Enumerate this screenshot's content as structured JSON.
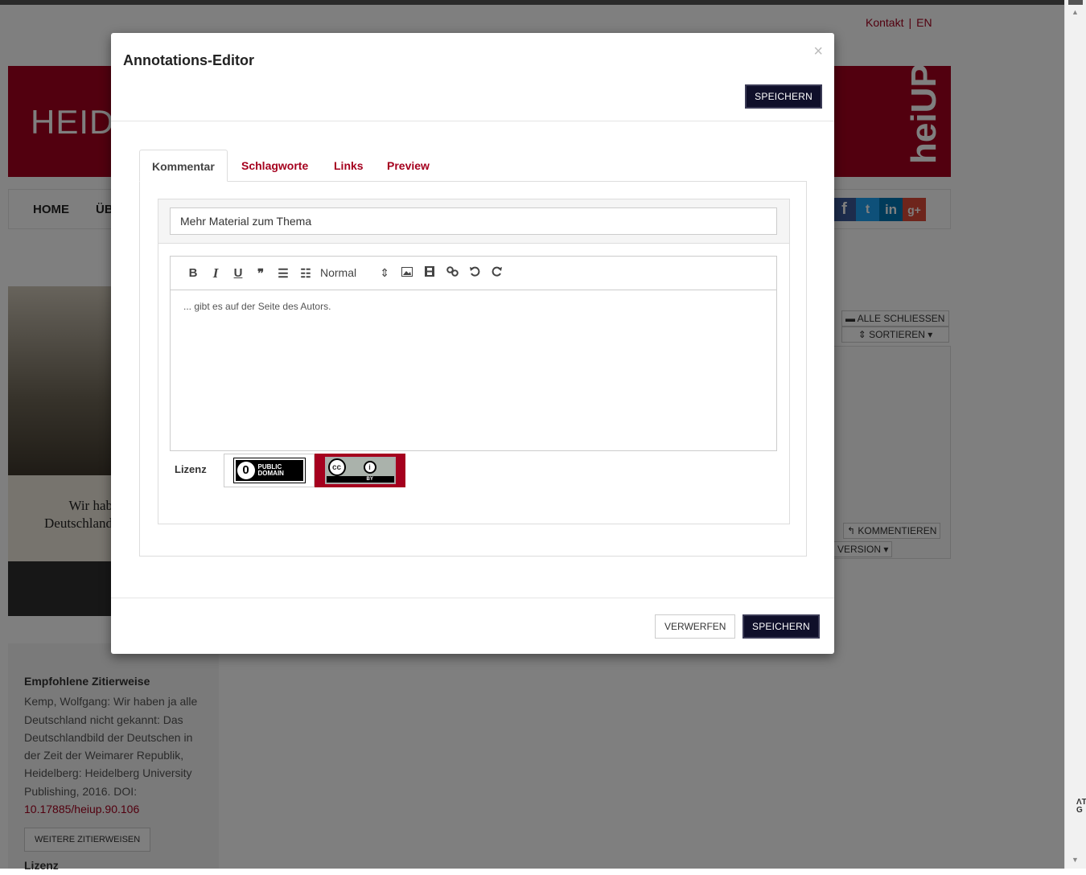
{
  "page": {
    "top_nav": {
      "contact": "Kontakt",
      "lang": "EN"
    },
    "brand": "HEID",
    "logo": "heiUP",
    "main_nav": [
      "HOME",
      "ÜB"
    ],
    "social": [
      "f",
      "t",
      "in",
      "g+"
    ],
    "cover": {
      "title_line1": "Wir hab",
      "title_line2": "Deutschland"
    },
    "right_buttons": {
      "close_all": "ALLE SCHLIESSEN",
      "sort": "SORTIEREN",
      "comment": "KOMMENTIEREN",
      "version": "VERSION"
    },
    "citation": {
      "heading": "Empfohlene Zitierweise",
      "text": "Kemp, Wolfgang: Wir haben ja alle Deutschland nicht gekannt: Das Deutschlandbild der Deutschen in der Zeit der Weimarer Republik, Heidelberg: Heidelberg University Publishing, 2016. DOI: ",
      "doi": "10.17885/heiup.90.106",
      "more_button": "WEITERE ZITIERWEISEN",
      "license_heading": "Lizenz"
    },
    "edge_text": "ɅT G"
  },
  "modal": {
    "title": "Annotations-Editor",
    "close": "×",
    "save_top": "SPEICHERN",
    "tabs": [
      {
        "label": "Kommentar",
        "active": true
      },
      {
        "label": "Schlagworte",
        "active": false
      },
      {
        "label": "Links",
        "active": false
      },
      {
        "label": "Preview",
        "active": false
      }
    ],
    "title_field": "Mehr Material zum Thema",
    "toolbar": {
      "bold": "B",
      "italic": "I",
      "underline": "U",
      "quote": "❞",
      "bullet_list": "☰",
      "ordered_list": "☷",
      "format_select": "Normal",
      "select_arrow": "⇕"
    },
    "editor_text": "... gibt es auf der Seite des Autors.",
    "license_label": "Lizenz",
    "license_pd": {
      "line1": "PUBLIC",
      "line2": "DOMAIN",
      "symbol": "0"
    },
    "license_cc": {
      "cc": "cc",
      "by_label": "BY"
    },
    "discard": "VERWERFEN",
    "save_bottom": "SPEICHERN"
  },
  "colors": {
    "brand_red": "#a5001e",
    "dark_button": "#0f0f2a"
  }
}
